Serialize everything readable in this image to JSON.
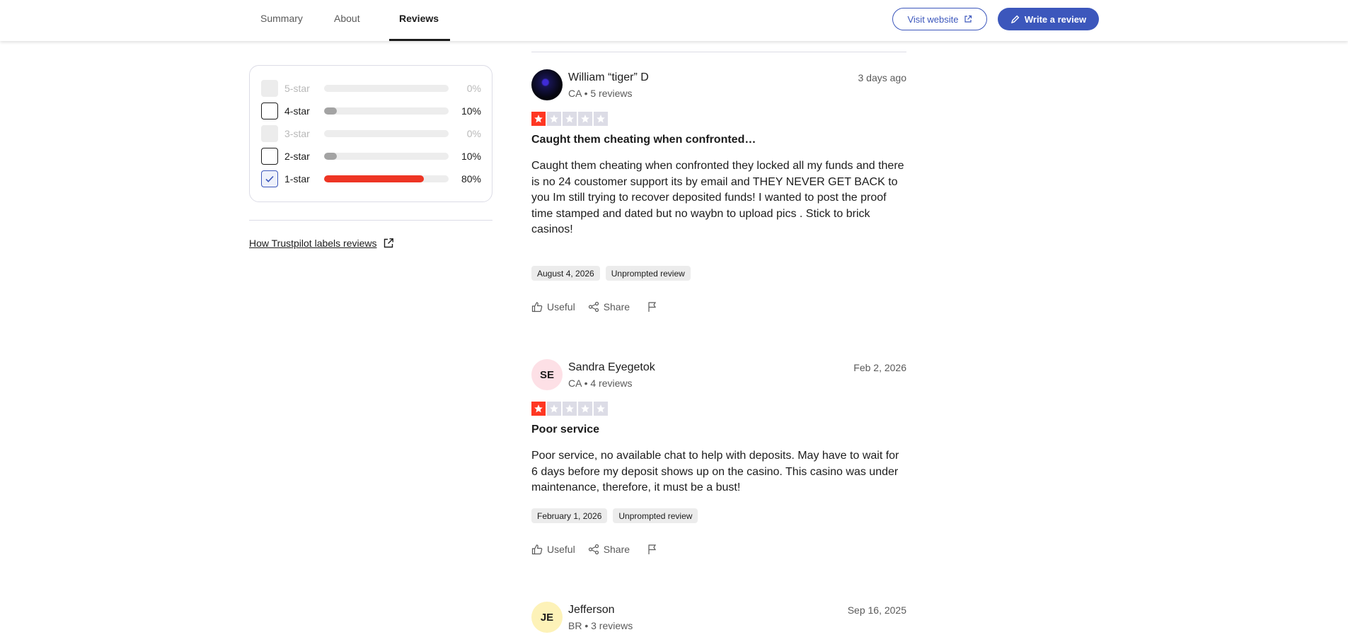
{
  "nav": {
    "tabs": [
      "Summary",
      "About",
      "Reviews"
    ],
    "active_tab": "Reviews",
    "visit_website": "Visit website",
    "write_review": "Write a review"
  },
  "filter": {
    "rows": [
      {
        "label": "5-star",
        "percent": "0%",
        "fill": 0,
        "checked": false,
        "disabled": true
      },
      {
        "label": "4-star",
        "percent": "10%",
        "fill": 0.1,
        "checked": false,
        "disabled": false
      },
      {
        "label": "3-star",
        "percent": "0%",
        "fill": 0,
        "checked": false,
        "disabled": true
      },
      {
        "label": "2-star",
        "percent": "10%",
        "fill": 0.1,
        "checked": false,
        "disabled": false
      },
      {
        "label": "1-star",
        "percent": "80%",
        "fill": 0.8,
        "checked": true,
        "disabled": false
      }
    ],
    "labels_link": "How Trustpilot labels reviews"
  },
  "reviews": [
    {
      "initials": "",
      "avatar_style": "photo",
      "name": "William “tiger” D",
      "meta": "CA • 5 reviews",
      "date": "3 days ago",
      "rating": 1,
      "title": "Caught them cheating when confronted…",
      "body": "Caught them cheating when confronted they locked all my funds and there is no 24 coustomer support its by email and THEY NEVER GET BACK to you Im still trying to recover deposited funds! I wanted to post the proof time stamped and dated but no waybn to upload pics . Stick to brick\ncasinos!",
      "experience_date": "August 4, 2026",
      "tag": "Unprompted review",
      "useful": "Useful",
      "share": "Share"
    },
    {
      "initials": "SE",
      "avatar_color": "#fde0e6",
      "name": "Sandra Eyegetok",
      "meta": "CA • 4 reviews",
      "date": "Feb 2, 2026",
      "rating": 1,
      "title": "Poor service",
      "body": "Poor service, no available chat to help with deposits. May have to wait for 6 days before my deposit shows up on the casino. This casino was under maintenance, therefore, it must be a bust!",
      "experience_date": "February 1, 2026",
      "tag": "Unprompted review",
      "useful": "Useful",
      "share": "Share"
    },
    {
      "initials": "JE",
      "avatar_color": "#fdf2b8",
      "name": "Jefferson",
      "meta": "BR • 3 reviews",
      "date": "Sep 16, 2025"
    }
  ]
}
